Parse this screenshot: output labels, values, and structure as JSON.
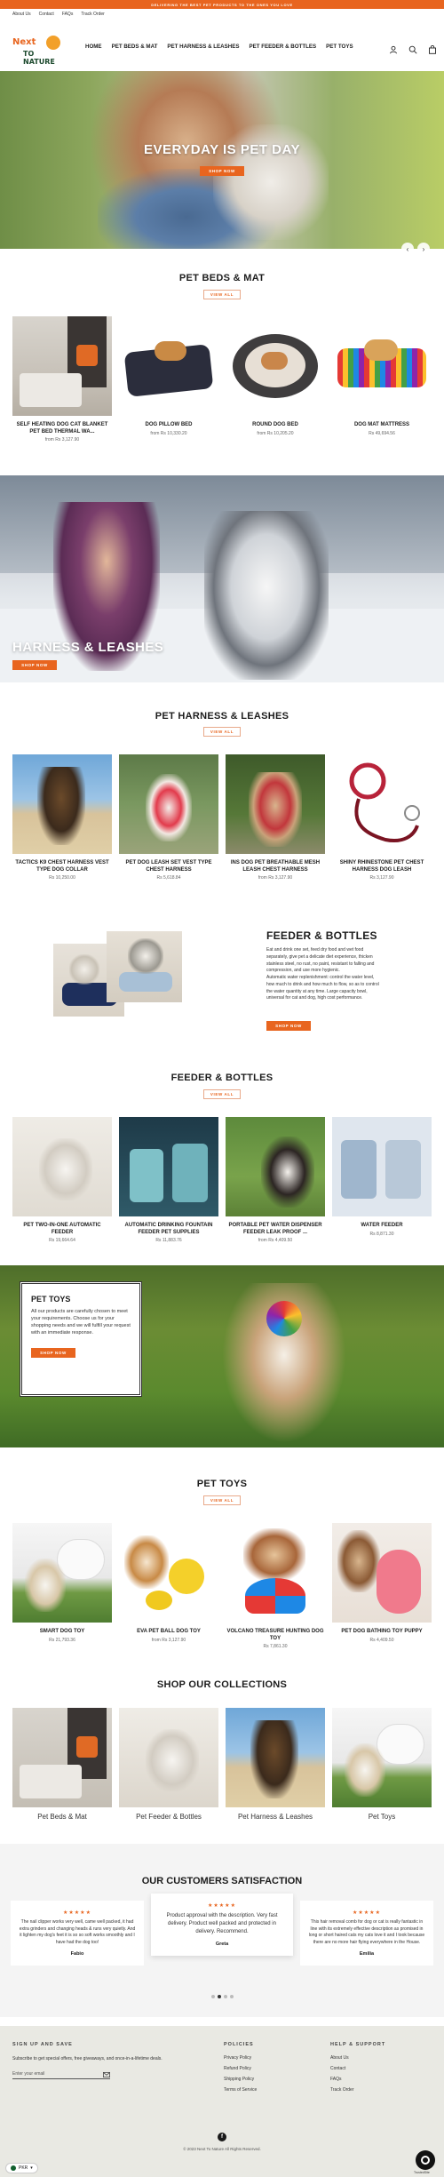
{
  "announcement": "DELIVERING THE BEST PET PRODUCTS TO THE ONES YOU LOVE",
  "top_links": [
    "About Us",
    "Contact",
    "FAQs",
    "Track Order"
  ],
  "logo": {
    "line1": "Next",
    "line2": "TO NATURE"
  },
  "nav": [
    "HOME",
    "PET BEDS & MAT",
    "PET HARNESS & LEASHES",
    "PET FEEDER & BOTTLES",
    "PET TOYS"
  ],
  "nav_icons": [
    "user-icon",
    "search-icon",
    "cart-icon"
  ],
  "hero": {
    "title": "EVERYDAY IS PET DAY",
    "button": "SHOP NOW"
  },
  "sections": {
    "beds": {
      "title": "PET BEDS & MAT",
      "view_all": "VIEW ALL",
      "products": [
        {
          "name": "SELF HEATING DOG CAT BLANKET PET BED THERMAL WA...",
          "price": "from Rs 3,127.90"
        },
        {
          "name": "DOG PILLOW BED",
          "price": "from Rs 10,330.20"
        },
        {
          "name": "ROUND DOG BED",
          "price": "from Rs 10,205.20"
        },
        {
          "name": "DOG MAT MATTRESS",
          "price": "Rs 49,694.56"
        }
      ]
    },
    "harness_banner": {
      "title": "HARNESS & LEASHES",
      "button": "SHOP NOW"
    },
    "harness": {
      "title": "PET HARNESS & LEASHES",
      "view_all": "VIEW ALL",
      "products": [
        {
          "name": "TACTICS K9 CHEST HARNESS VEST TYPE DOG COLLAR",
          "price": "Rs 10,250.00"
        },
        {
          "name": "PET DOG LEASH SET VEST TYPE CHEST HARNESS",
          "price": "Rs 5,618.84"
        },
        {
          "name": "INS DOG PET BREATHABLE MESH LEASH CHEST HARNESS",
          "price": "from Rs 3,127.90"
        },
        {
          "name": "SHINY RHINESTONE PET CHEST HARNESS DOG LEASH",
          "price": "Rs 3,127.90"
        }
      ]
    },
    "feeder_feature": {
      "title": "FEEDER & BOTTLES",
      "lines": [
        "Eat and drink one set, feed dry food and wet food",
        "separately, give pet a delicate diet experience, thicken",
        "stainless steel, no rust, no paint, resistant to falling and",
        "compression, and use more hygienic.",
        "Automatic water replenishment: control the water level,",
        "how much to drink and how much to flow, so as to control",
        "the water quantity at any time. Large capacity bowl,",
        "universal for cat and dog, high cost performance."
      ],
      "button": "SHOP NOW"
    },
    "feeders": {
      "title": "FEEDER & BOTTLES",
      "view_all": "VIEW ALL",
      "products": [
        {
          "name": "PET TWO-IN-ONE AUTOMATIC FEEDER",
          "price": "Rs 19,664.64"
        },
        {
          "name": "AUTOMATIC DRINKING FOUNTAIN FEEDER PET SUPPLIES",
          "price": "Rs 11,883.76"
        },
        {
          "name": "PORTABLE PET WATER DISPENSER FEEDER LEAK PROOF ...",
          "price": "from Rs 4,409.50"
        },
        {
          "name": "WATER FEEDER",
          "price": "Rs 8,871.30"
        }
      ]
    },
    "toys_banner": {
      "title": "PET TOYS",
      "text": "All our products are carefully chosen to meet your requirements. Choose us for your shopping needs and we will fulfill your request with an immediate response.",
      "button": "SHOP NOW"
    },
    "toys": {
      "title": "PET TOYS",
      "view_all": "VIEW ALL",
      "products": [
        {
          "name": "SMART DOG TOY",
          "price": "Rs 21,793.36"
        },
        {
          "name": "EVA PET BALL DOG TOY",
          "price": "from Rs 3,127.90"
        },
        {
          "name": "VOLCANO TREASURE HUNTING DOG TOY",
          "price": "Rs 7,861.30"
        },
        {
          "name": "PET DOG BATHING TOY PUPPY",
          "price": "Rs 4,409.50"
        }
      ]
    },
    "collections": {
      "title": "SHOP OUR COLLECTIONS",
      "items": [
        "Pet Beds & Mat",
        "Pet Feeder & Bottles",
        "Pet Harness & Leashes",
        "Pet Toys"
      ]
    },
    "reviews": {
      "title": "OUR CUSTOMERS SATISFACTION",
      "items": [
        {
          "stars": "★★★★★",
          "text": "The nail clipper works very well, came well packed, it had extra grinders and changing heads & runs very quietly. And it lighten my dog's feet it is so so soft works smoothly and I have had the dog too!",
          "name": "Fabio"
        },
        {
          "stars": "★★★★★",
          "text": "Product approval with the description. Very fast delivery. Product well packed and protected in delivery. Recommend.",
          "name": "Greta"
        },
        {
          "stars": "★★★★★",
          "text": "This hair removal comb for dog or cat is really fantastic in line with its extremely effective description as promised in long or short haired cats my cats love it and I took because there are no more hair flying everywhere in the House.",
          "name": "Emilia"
        }
      ]
    }
  },
  "footer": {
    "signup_title": "SIGN UP AND SAVE",
    "signup_text": "Subscribe to get special offers, free giveaways, and once-in-a-lifetime deals.",
    "email_placeholder": "Enter your email",
    "policies_title": "POLICIES",
    "policies": [
      "Privacy Policy",
      "Refund Policy",
      "Shipping Policy",
      "Terms of Service"
    ],
    "help_title": "HELP & SUPPORT",
    "help": [
      "About Us",
      "Contact",
      "FAQs",
      "Track Order"
    ],
    "copyright": "© 2023 Next To Nature All Rights Reserved.",
    "currency": "PKR",
    "trustedsite": "TrustedSite"
  },
  "colors": {
    "accent": "#e8651f",
    "footer_bg": "#e9e9e3",
    "reviews_bg": "#f4f4f4"
  }
}
